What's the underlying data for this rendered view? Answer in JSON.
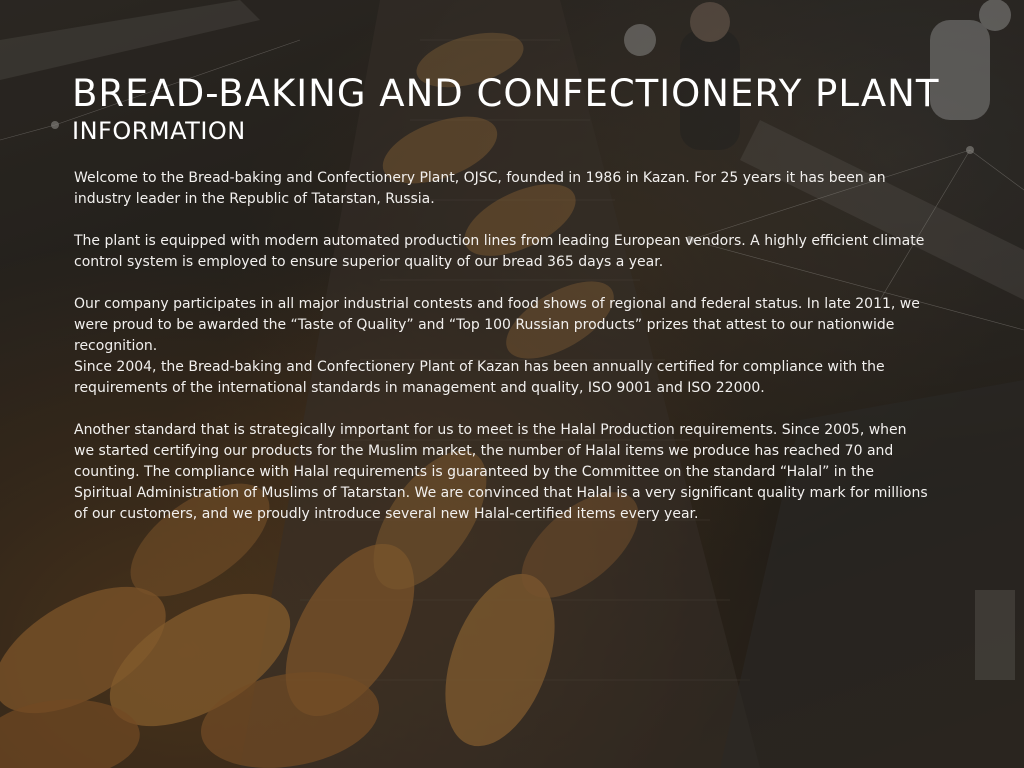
{
  "page": {
    "title": "BREAD-BAKING AND CONFECTIONERY PLANT",
    "subtitle": "INFORMATION",
    "paragraphs": [
      "Welcome to the Bread-baking and Confectionery Plant, OJSC, founded in 1986 in Kazan. For 25 years it has been an industry leader in the Republic of Tatarstan, Russia.",
      "The plant is equipped with modern automated production lines from leading European vendors. A highly efficient climate control system is employed to ensure superior quality of our bread 365 days a year.",
      "Our company participates in all major industrial contests and food shows of regional and federal status. In late 2011, we were proud to be awarded the “Taste of Quality” and “Top 100 Russian products” prizes that attest to our nationwide recognition.",
      "Since 2004, the Bread-baking and Confectionery Plant of Kazan has been annually certified for compliance with the requirements of the international standards in management and quality, ISO 9001 and ISO 22000.",
      "Another standard that is strategically important for us to meet is the Halal Production requirements. Since 2005, when we started certifying our products for the Muslim market, the number of Halal items we produce has reached 70 and counting. The compliance with Halal requirements is guaranteed by the Committee on the standard “Halal” in the Spiritual Administration of Muslims of Tatarstan. We are convinced that Halal is a very significant quality mark for millions of our customers, and we proudly introduce several new Halal-certified items every year."
    ]
  },
  "colors": {
    "text": "#ffffff",
    "overlay": "#0f0d0c"
  }
}
